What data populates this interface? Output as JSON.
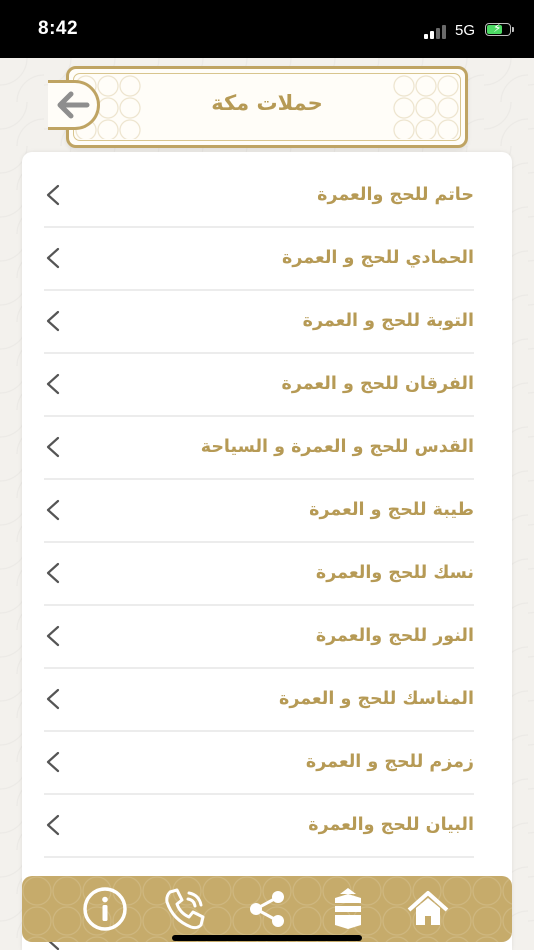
{
  "status_bar": {
    "time": "8:42",
    "network": "5G",
    "battery_percent": 60
  },
  "header": {
    "title": "حملات مكة",
    "back_icon": "arrow-left-icon"
  },
  "list": {
    "items": [
      {
        "label": "حاتم للحج والعمرة"
      },
      {
        "label": "الحمادي للحج و العمرة"
      },
      {
        "label": "التوبة للحج و العمرة"
      },
      {
        "label": "الفرقان للحج و العمرة"
      },
      {
        "label": "القدس للحج و العمرة و السياحة"
      },
      {
        "label": "طيبة للحج و العمرة"
      },
      {
        "label": "نسك للحج والعمرة"
      },
      {
        "label": "النور للحج والعمرة"
      },
      {
        "label": "المناسك للحج و العمرة"
      },
      {
        "label": "زمزم للحج و العمرة"
      },
      {
        "label": "البيان للحج والعمرة"
      }
    ],
    "chevron_icon": "chevron-left-icon"
  },
  "bottom_nav": {
    "items": [
      {
        "icon": "info-icon"
      },
      {
        "icon": "phone-icon"
      },
      {
        "icon": "share-icon"
      },
      {
        "icon": "kaaba-icon"
      },
      {
        "icon": "home-icon"
      }
    ]
  },
  "colors": {
    "gold": "#b69a55",
    "nav_bg": "#c6ab6b",
    "border": "#bfa463"
  }
}
